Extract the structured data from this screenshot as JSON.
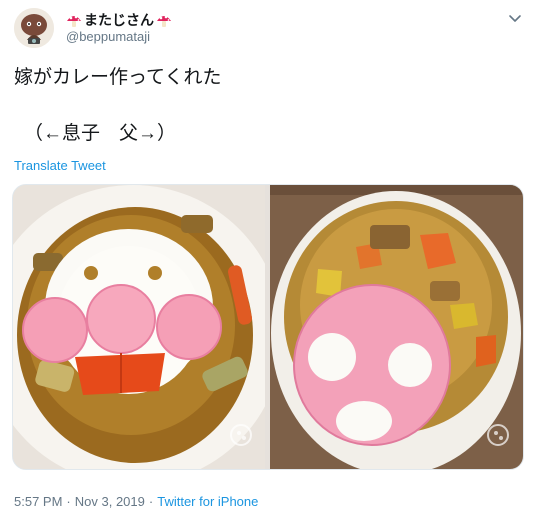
{
  "author": {
    "display_name": "またじさん",
    "handle": "@beppumataji"
  },
  "tweet": {
    "text_line1": "嫁がカレー作ってくれた",
    "text_line2": "（←息子　父→）",
    "translate_label": "Translate Tweet"
  },
  "media": {
    "photos": [
      {
        "description_icon": "curry-plate-smiley"
      },
      {
        "description_icon": "curry-bowl-ham-face"
      }
    ]
  },
  "meta": {
    "time": "5:57 PM",
    "separator": "·",
    "date": "Nov 3, 2019",
    "source": "Twitter for iPhone"
  },
  "colors": {
    "link": "#1b95e0",
    "secondary_text": "#657786",
    "primary_text": "#14171a"
  },
  "icons": [
    "avatar-icon",
    "mushroom-icon",
    "chevron-down-icon"
  ]
}
